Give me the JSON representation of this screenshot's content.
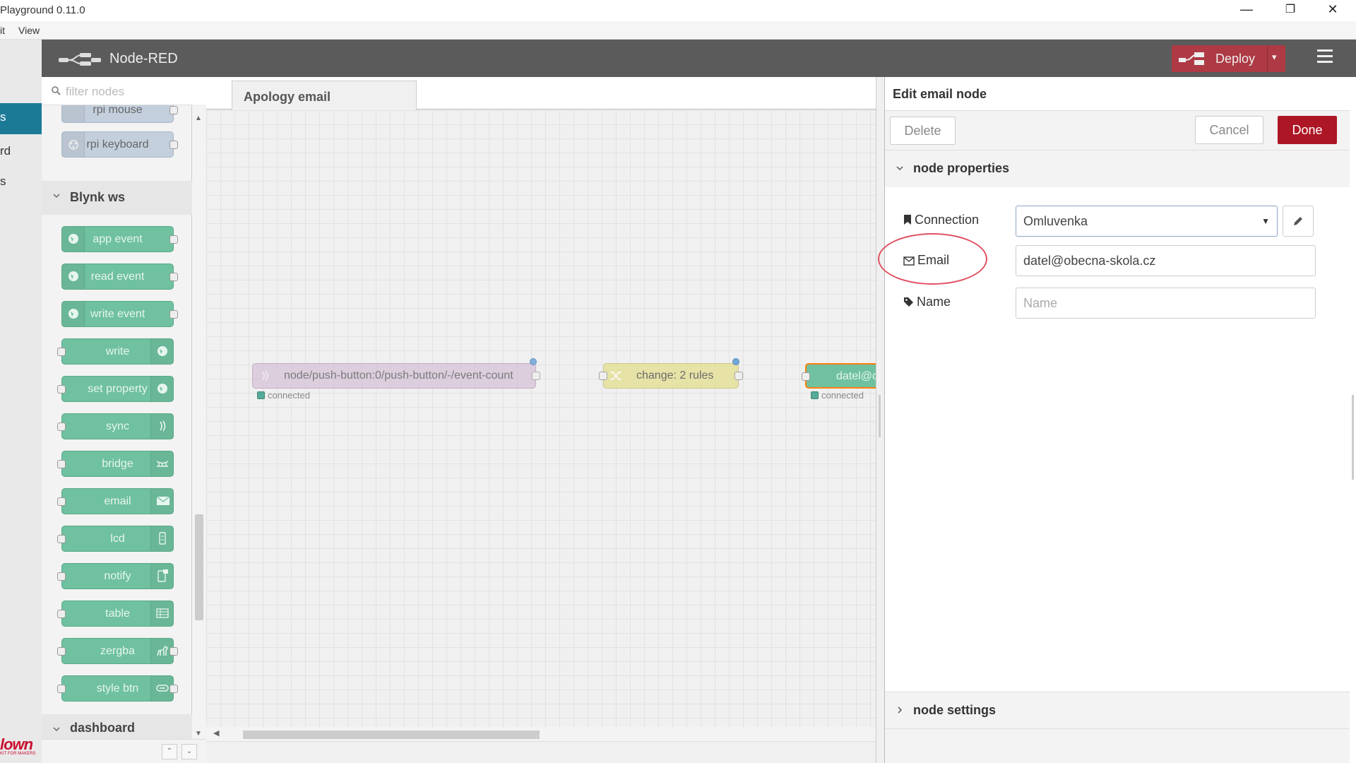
{
  "window": {
    "title": "Playground 0.11.0",
    "minimize": "—",
    "restore": "❐",
    "close": "✕"
  },
  "menu": {
    "items": [
      "it",
      "View"
    ]
  },
  "left_strip": {
    "items": [
      "s",
      "rd",
      "s"
    ],
    "logo": "lown",
    "logo_sub": "KIT FOR MAKERS"
  },
  "header": {
    "brand": "Node-RED",
    "deploy_label": "Deploy",
    "deploy_caret": "▾"
  },
  "palette": {
    "filter_placeholder": "filter nodes",
    "partial_nodes": [
      {
        "label": "rpi mouse"
      },
      {
        "label": "rpi keyboard"
      }
    ],
    "category_blynk": "Blynk ws",
    "blynk_nodes": [
      {
        "label": "app event",
        "icon": "blynk-globe-icon"
      },
      {
        "label": "read event",
        "icon": "blynk-globe-icon"
      },
      {
        "label": "write event",
        "icon": "blynk-globe-icon"
      },
      {
        "label": "write",
        "icon": "blynk-globe-icon"
      },
      {
        "label": "set property",
        "icon": "blynk-globe-icon"
      },
      {
        "label": "sync",
        "icon": "sync-wave-icon"
      },
      {
        "label": "bridge",
        "icon": "bridge-icon"
      },
      {
        "label": "email",
        "icon": "envelope-icon"
      },
      {
        "label": "lcd",
        "icon": "lcd-icon"
      },
      {
        "label": "notify",
        "icon": "phone-notify-icon"
      },
      {
        "label": "table",
        "icon": "table-icon"
      },
      {
        "label": "zergba",
        "icon": "zergba-icon"
      },
      {
        "label": "style btn",
        "icon": "style-btn-icon"
      }
    ],
    "category_dashboard": "dashboard"
  },
  "workspace": {
    "tab_label": "Apology email",
    "flow_nodes": [
      {
        "label": "node/push-button:0/push-button/-/event-count",
        "status": "connected"
      },
      {
        "label": "change: 2 rules"
      },
      {
        "label": "datel@o",
        "status": "connected"
      }
    ]
  },
  "editor": {
    "title": "Edit email node",
    "delete_label": "Delete",
    "cancel_label": "Cancel",
    "done_label": "Done",
    "section_properties": "node properties",
    "section_settings": "node settings",
    "fields": {
      "connection_label": "Connection",
      "connection_value": "Omluvenka",
      "email_label": "Email",
      "email_value": "datel@obecna-skola.cz",
      "name_label": "Name",
      "name_placeholder": "Name"
    }
  },
  "colors": {
    "header_bg": "#5b5b5b",
    "deploy_bg": "#ad3a44",
    "done_bg": "#ad1625",
    "blynk_node": "#6fc1a0",
    "highlight_circle": "#e05060",
    "selected_tab": "#1b7b97"
  }
}
